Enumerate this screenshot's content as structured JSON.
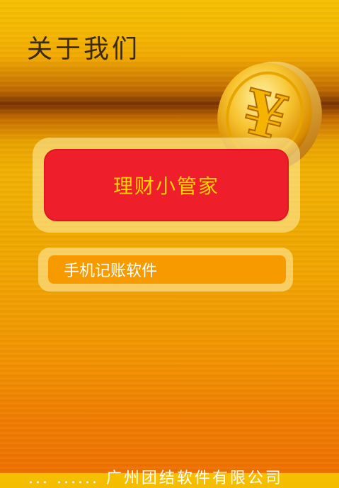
{
  "header": {
    "title": "关于我们"
  },
  "app": {
    "name": "理财小管家",
    "description": "手机记账软件"
  },
  "footer": {
    "text": "... ...... 广州团结软件有限公司"
  },
  "coin": {
    "symbol": "¥",
    "icon": "yuan-coin-icon"
  },
  "colors": {
    "title": "#3a2a10",
    "app_box": "#ee1e2a",
    "app_name": "#ffd400",
    "description_box": "#f79a00",
    "description_text": "#ffffff"
  }
}
